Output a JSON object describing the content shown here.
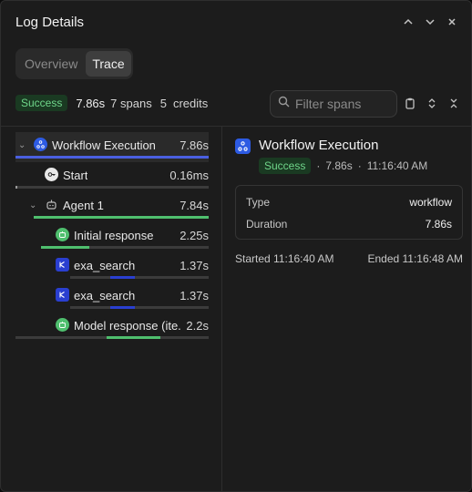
{
  "header": {
    "title": "Log Details"
  },
  "tabs": [
    {
      "label": "Overview"
    },
    {
      "label": "Trace"
    }
  ],
  "summary": {
    "status": "Success",
    "duration": "7.86s",
    "spans": "7 spans",
    "credits_count": "5",
    "credits_label": "credits"
  },
  "filter": {
    "placeholder": "Filter spans",
    "value": ""
  },
  "colors": {
    "accent_blue": "#4a5fe0",
    "accent_green": "#4fbf6e",
    "success_bg": "#1a3a22",
    "success_text": "#6fd68a"
  },
  "spans": [
    {
      "label": "Workflow Execution",
      "duration": "7.86s",
      "icon": "workflow-icon",
      "progress_start": 0.0,
      "progress_end": 1.0,
      "bar_color": "#4a5fe0"
    },
    {
      "label": "Start",
      "duration": "0.16ms",
      "icon": "key-icon",
      "progress_start": 0.0,
      "progress_end": 0.01,
      "bar_color": "#9a9a9a"
    },
    {
      "label": "Agent 1",
      "duration": "7.84s",
      "icon": "robot-icon",
      "progress_start": 0.0,
      "progress_end": 1.0,
      "bar_color": "#4fbf6e"
    },
    {
      "label": "Initial response",
      "duration": "2.25s",
      "icon": "openai-icon",
      "progress_start": 0.0,
      "progress_end": 0.29,
      "bar_color": "#4fbf6e"
    },
    {
      "label": "exa_search",
      "duration": "1.37s",
      "icon": "exa-icon",
      "progress_start": 0.29,
      "progress_end": 0.47,
      "bar_color": "#2a3fd0"
    },
    {
      "label": "exa_search",
      "duration": "1.37s",
      "icon": "exa-icon",
      "progress_start": 0.29,
      "progress_end": 0.47,
      "bar_color": "#2a3fd0"
    },
    {
      "label": "Model response (ite...",
      "duration": "2.2s",
      "icon": "openai-icon",
      "progress_start": 0.47,
      "progress_end": 0.75,
      "bar_color": "#4fbf6e"
    }
  ],
  "detail": {
    "title": "Workflow Execution",
    "status": "Success",
    "duration": "7.86s",
    "time": "11:16:40 AM",
    "separator": "·",
    "type_label": "Type",
    "type_value": "workflow",
    "duration_label": "Duration",
    "duration_value": "7.86s",
    "started": "Started 11:16:40 AM",
    "ended": "Ended 11:16:48 AM"
  }
}
